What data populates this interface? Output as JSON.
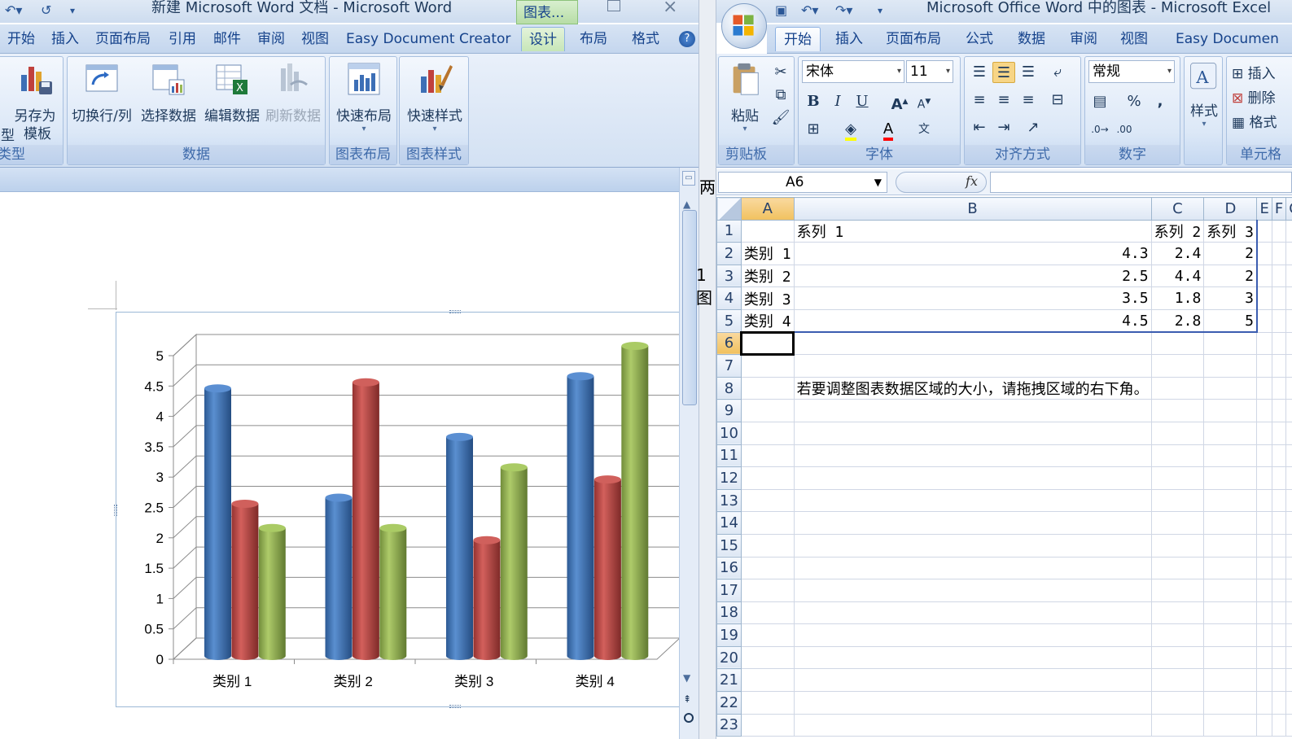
{
  "word": {
    "title": "新建 Microsoft Word 文档 - Microsoft Word",
    "chart_tools_tab": "图表...",
    "menu_tabs": [
      "开始",
      "插入",
      "页面布局",
      "引用",
      "邮件",
      "审阅",
      "视图",
      "Easy Document Creator",
      "设计",
      "布局",
      "格式"
    ],
    "ribbon": {
      "type_group": {
        "button": "另存为",
        "button2": "模板",
        "button_left": "型",
        "label": "类型"
      },
      "data_group": {
        "buttons": [
          "切换行/列",
          "选择数据",
          "编辑数据",
          "刷新数据"
        ],
        "label": "数据"
      },
      "layout_group": {
        "button": "快速布局",
        "label": "图表布局"
      },
      "style_group": {
        "button": "快速样式",
        "label": "图表样式"
      }
    },
    "side_text": [
      "两",
      "1图"
    ]
  },
  "chart_data": {
    "type": "bar",
    "style": "3d-cylinder",
    "categories": [
      "类别 1",
      "类别 2",
      "类别 3",
      "类别 4"
    ],
    "series": [
      {
        "name": "系列 1",
        "values": [
          4.3,
          2.5,
          3.5,
          4.5
        ],
        "color": "#4a7ebb"
      },
      {
        "name": "系列 2",
        "values": [
          2.4,
          4.4,
          1.8,
          2.8
        ],
        "color": "#be4b48"
      },
      {
        "name": "系列 3",
        "values": [
          2,
          2,
          3,
          5
        ],
        "color": "#98b954"
      }
    ],
    "ylim": [
      0,
      5
    ],
    "yticks": [
      "0",
      "0.5",
      "1",
      "1.5",
      "2",
      "2.5",
      "3",
      "3.5",
      "4",
      "4.5",
      "5"
    ],
    "grid": true,
    "legend": "none"
  },
  "excel": {
    "title": "Microsoft Office Word 中的图表 - Microsoft Excel",
    "menu_tabs": [
      "开始",
      "插入",
      "页面布局",
      "公式",
      "数据",
      "审阅",
      "视图",
      "Easy Documen"
    ],
    "ribbon": {
      "paste": "粘贴",
      "clipboard_label": "剪贴板",
      "font_name": "宋体",
      "font_size": "11",
      "font_label": "字体",
      "align_label": "对齐方式",
      "number_format": "常规",
      "number_label": "数字",
      "style": "样式",
      "insert": "插入",
      "delete": "删除",
      "format": "格式",
      "cells_label": "单元格"
    },
    "name_box": "A6",
    "fx": "fx",
    "columns": [
      "A",
      "B",
      "C",
      "D",
      "E",
      "F",
      "G"
    ],
    "rows": [
      [
        "",
        "系列 1",
        "系列 2",
        "系列 3",
        "",
        "",
        ""
      ],
      [
        "类别 1",
        "4.3",
        "2.4",
        "2",
        "",
        "",
        ""
      ],
      [
        "类别 2",
        "2.5",
        "4.4",
        "2",
        "",
        "",
        ""
      ],
      [
        "类别 3",
        "3.5",
        "1.8",
        "3",
        "",
        "",
        ""
      ],
      [
        "类别 4",
        "4.5",
        "2.8",
        "5",
        "",
        "",
        ""
      ],
      [
        "",
        "",
        "",
        "",
        "",
        "",
        ""
      ],
      [
        "",
        "",
        "",
        "",
        "",
        "",
        ""
      ],
      [
        "",
        "若要调整图表数据区域的大小，请拖拽区域的右下角。",
        "",
        "",
        "",
        "",
        ""
      ]
    ],
    "row_numbers": [
      "1",
      "2",
      "3",
      "4",
      "5",
      "6",
      "7",
      "8",
      "9",
      "10",
      "11",
      "12",
      "13",
      "14",
      "15",
      "16",
      "17",
      "18",
      "19",
      "20",
      "21",
      "22",
      "23"
    ]
  }
}
